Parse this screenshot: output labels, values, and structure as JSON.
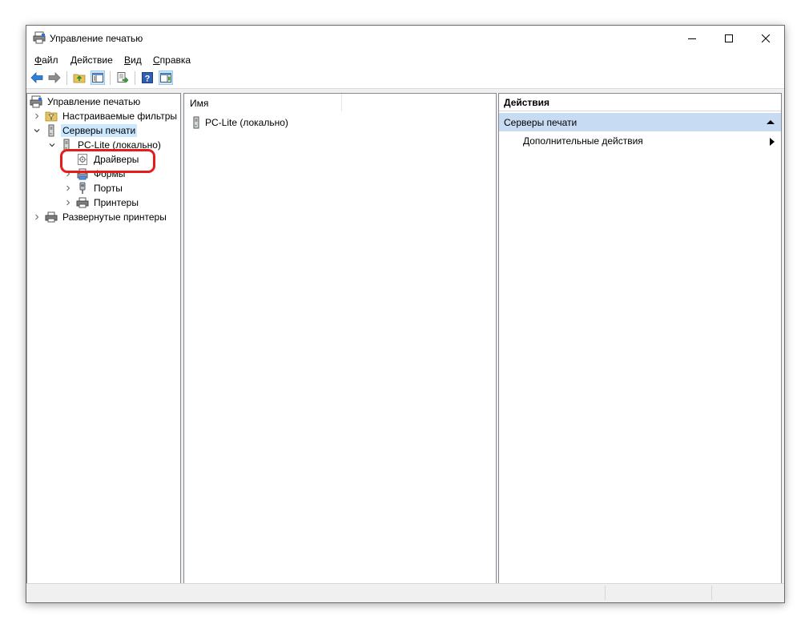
{
  "window": {
    "title": "Управление печатью"
  },
  "menu": [
    {
      "label": "Файл",
      "key": "Ф",
      "rest": "айл"
    },
    {
      "label": "Действие",
      "key": "Д",
      "rest": "ействие"
    },
    {
      "label": "Вид",
      "key": "В",
      "rest": "ид"
    },
    {
      "label": "Справка",
      "key": "С",
      "rest": "правка"
    }
  ],
  "toolbar": {
    "icons": [
      "back-arrow-icon",
      "forward-arrow-icon",
      "up-folder-icon",
      "show-hide-tree-icon",
      "export-list-icon",
      "help-icon",
      "show-hide-action-pane-icon"
    ]
  },
  "tree": {
    "root": "Управление печатью",
    "items": [
      {
        "label": "Настраиваемые фильтры",
        "level": 1,
        "expander": "collapsed"
      },
      {
        "label": "Серверы печати",
        "level": 1,
        "expander": "expanded",
        "selected": true
      },
      {
        "label": "PC-Lite (локально)",
        "level": 2,
        "expander": "expanded"
      },
      {
        "label": "Драйверы",
        "level": 3,
        "expander": "none"
      },
      {
        "label": "Формы",
        "level": 3,
        "expander": "collapsed"
      },
      {
        "label": "Порты",
        "level": 3,
        "expander": "collapsed"
      },
      {
        "label": "Принтеры",
        "level": 3,
        "expander": "collapsed"
      },
      {
        "label": "Развернутые принтеры",
        "level": 1,
        "expander": "collapsed"
      }
    ]
  },
  "list": {
    "column_name": "Имя",
    "rows": [
      "PC-Lite (локально)"
    ]
  },
  "actions": {
    "header": "Действия",
    "section": "Серверы печати",
    "more": "Дополнительные действия"
  },
  "colors": {
    "selection": "#cce8ff",
    "section_bg": "#c7dcf2",
    "highlight": "#e81b1b"
  }
}
